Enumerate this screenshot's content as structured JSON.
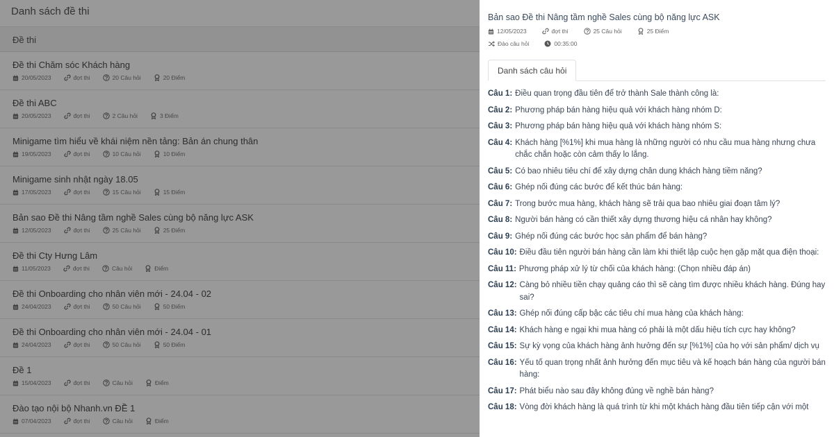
{
  "page": {
    "title": "Danh sách đề thi",
    "section_header": "Đề thi"
  },
  "exams": [
    {
      "title": "Đề thi Chăm sóc Khách hàng",
      "date": "20/05/2023",
      "round": "đợt thi",
      "questions": "20 Câu hỏi",
      "points": "20 Điểm"
    },
    {
      "title": "Đề thi ABC",
      "date": "20/05/2023",
      "round": "đợt thi",
      "questions": "2 Câu hỏi",
      "points": "3 Điểm"
    },
    {
      "title": "Minigame tìm hiểu về khái niệm nền tảng: Bản án chung thân",
      "date": "19/05/2023",
      "round": "đợt thi",
      "questions": "10 Câu hỏi",
      "points": "10 Điểm"
    },
    {
      "title": "Minigame sinh nhật ngày 18.05",
      "date": "17/05/2023",
      "round": "đợt thi",
      "questions": "15 Câu hỏi",
      "points": "15 Điểm"
    },
    {
      "title": "Bản sao Đề thi Nâng tầm nghề Sales cùng bộ năng lực ASK",
      "date": "12/05/2023",
      "round": "đợt thi",
      "questions": "25 Câu hỏi",
      "points": "25 Điểm"
    },
    {
      "title": "Đề thi Cty Hưng Lâm",
      "date": "11/05/2023",
      "round": "đợt thi",
      "questions": "Câu hỏi",
      "points": "Điểm"
    },
    {
      "title": "Đề thi Onboarding cho nhân viên mới - 24.04 - 02",
      "date": "24/04/2023",
      "round": "đợt thi",
      "questions": "50 Câu hỏi",
      "points": "50 Điểm"
    },
    {
      "title": "Đề thi Onboarding cho nhân viên mới - 24.04 - 01",
      "date": "24/04/2023",
      "round": "đợt thi",
      "questions": "50 Câu hỏi",
      "points": "50 Điểm"
    },
    {
      "title": "Đề 1",
      "date": "15/04/2023",
      "round": "đợt thi",
      "questions": "Câu hỏi",
      "points": "Điểm"
    },
    {
      "title": "Đào tạo nội bộ Nhanh.vn ĐỀ 1",
      "date": "07/04/2023",
      "round": "đợt thi",
      "questions": "Câu hỏi",
      "points": "Điểm"
    }
  ],
  "drawer": {
    "title": "Bản sao Đề thi Nâng tầm nghề Sales cùng bộ năng lực ASK",
    "date": "12/05/2023",
    "round": "đợt thi",
    "questions": "25 Câu hỏi",
    "points": "25 Điểm",
    "shuffle": "Đảo câu hỏi",
    "duration": "00:35:00",
    "tab_label": "Danh sách câu hỏi",
    "question_list": [
      {
        "num": "Câu 1:",
        "text": "Điều quan trọng đầu tiên để trở thành Sale thành công là:"
      },
      {
        "num": "Câu 2:",
        "text": "Phương pháp bán hàng hiệu quả với khách hàng nhóm D:"
      },
      {
        "num": "Câu 3:",
        "text": "Phương pháp bán hàng hiệu quả với khách hàng nhóm S:"
      },
      {
        "num": "Câu 4:",
        "text": "Khách hàng [%1%] khi mua hàng là những người có nhu cầu mua hàng nhưng chưa chắc chắn hoặc còn cảm thấy lo lắng."
      },
      {
        "num": "Câu 5:",
        "text": "Có bao nhiêu tiêu chí để xây dựng chân dung khách hàng tiềm năng?"
      },
      {
        "num": "Câu 6:",
        "text": "Ghép nối đúng các bước để kết thúc bán hàng:"
      },
      {
        "num": "Câu 7:",
        "text": "Trong bước mua hàng, khách hàng sẽ trải qua bao nhiêu giai đoạn tâm lý?"
      },
      {
        "num": "Câu 8:",
        "text": "Người bán hàng có cần thiết xây dựng thương hiệu cá nhân hay không?"
      },
      {
        "num": "Câu 9:",
        "text": "Ghép nối đúng các bước học sản phẩm để bán hàng?"
      },
      {
        "num": "Câu 10:",
        "text": "Điều đầu tiên người bán hàng cần làm khi thiết lập cuộc hẹn gặp mặt qua điện thoại:"
      },
      {
        "num": "Câu 11:",
        "text": "Phương pháp xử lý từ chối của khách hàng: (Chọn nhiều đáp án)"
      },
      {
        "num": "Câu 12:",
        "text": "Càng bỏ nhiều tiền chạy quảng cáo thì sẽ càng tìm được nhiều khách hàng. Đúng hay sai?"
      },
      {
        "num": "Câu 13:",
        "text": "Ghép nối đúng cấp bậc các tiêu chí mua hàng của khách hàng:"
      },
      {
        "num": "Câu 14:",
        "text": "Khách hàng e ngại khi mua hàng có phải là một dấu hiệu tích cực hay không?"
      },
      {
        "num": "Câu 15:",
        "text": "Sự kỳ vọng của khách hàng ảnh hưởng đến sự [%1%] của họ với sản phẩm/ dịch vụ"
      },
      {
        "num": "Câu 16:",
        "text": "Yếu tố quan trọng nhất ảnh hưởng đến mục tiêu và kế hoạch bán hàng của người bán hàng:"
      },
      {
        "num": "Câu 17:",
        "text": "Phát biểu nào sau đây không đúng về nghề bán hàng?"
      },
      {
        "num": "Câu 18:",
        "text": "Vòng đời khách hàng là quá trình từ khi một khách hàng đầu tiên tiếp cận với một"
      }
    ]
  },
  "icons": {
    "calendar": "calendar-icon",
    "link": "link-icon",
    "question": "question-circle-icon",
    "award": "award-icon",
    "shuffle": "shuffle-icon",
    "clock": "clock-icon"
  },
  "colors": {
    "overlay": "#000000",
    "drawer_bg": "#ffffff",
    "text": "#3b4656"
  }
}
